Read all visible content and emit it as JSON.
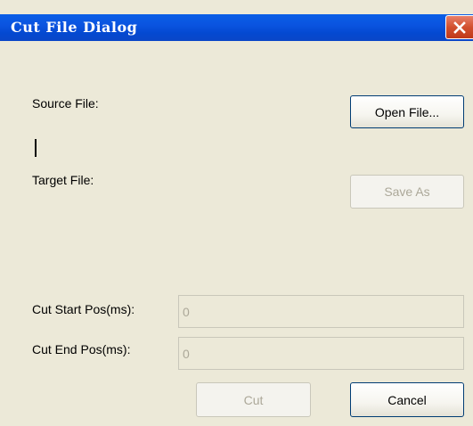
{
  "window": {
    "title": "Cut File Dialog",
    "close_icon": "close-icon"
  },
  "source": {
    "label": "Source File:",
    "path": ""
  },
  "target": {
    "label": "Target File:",
    "path": ""
  },
  "buttons": {
    "open_file": "Open File...",
    "save_as": "Save As",
    "cut": "Cut",
    "cancel": "Cancel"
  },
  "cut_start": {
    "label": "Cut Start Pos(ms):",
    "value": "0"
  },
  "cut_end": {
    "label": "Cut End Pos(ms):",
    "value": "0"
  },
  "colors": {
    "titlebar": "#0a54e0",
    "close_button": "#d2502e",
    "dialog_background": "#ece9d8",
    "disabled_text": "#aca899"
  }
}
